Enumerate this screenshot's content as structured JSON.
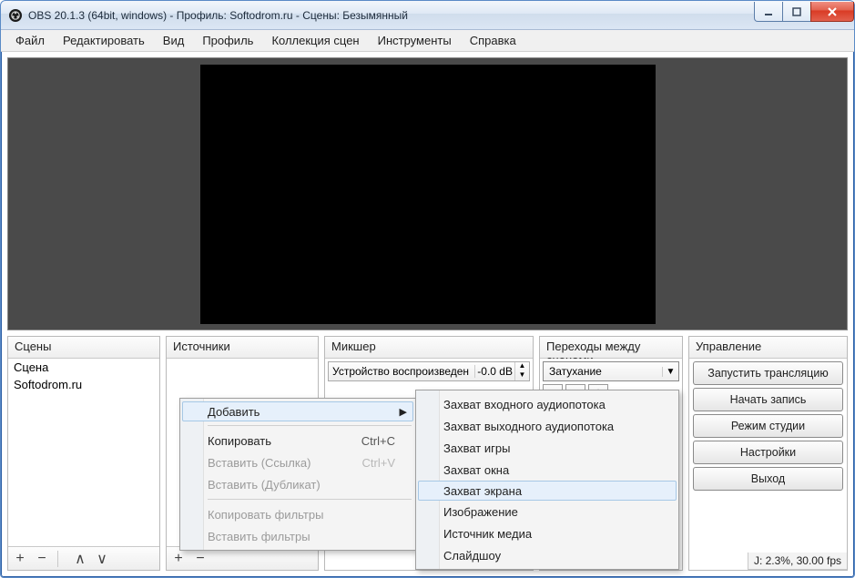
{
  "title": "OBS 20.1.3 (64bit, windows) - Профиль: Softodrom.ru - Сцены: Безымянный",
  "menubar": [
    "Файл",
    "Редактировать",
    "Вид",
    "Профиль",
    "Коллекция сцен",
    "Инструменты",
    "Справка"
  ],
  "panels": {
    "scenes": {
      "header": "Сцены",
      "items": [
        "Сцена",
        "Softodrom.ru"
      ]
    },
    "sources": {
      "header": "Источники"
    },
    "mixer": {
      "header": "Микшер",
      "device": "Устройство воспроизведен",
      "db": "-0.0 dB"
    },
    "transitions": {
      "header": "Переходы между сценами",
      "value": "Затухание"
    },
    "controls": {
      "header": "Управление",
      "buttons": [
        "Запустить трансляцию",
        "Начать запись",
        "Режим студии",
        "Настройки",
        "Выход"
      ]
    }
  },
  "footer_btns": {
    "plus": "+",
    "minus": "−",
    "up": "∧",
    "down": "∨",
    "gear": "⚙"
  },
  "status": "J: 2.3%, 30.00 fps",
  "ctx1": {
    "add": "Добавить",
    "copy": "Копировать",
    "copy_sc": "Ctrl+C",
    "paste_link": "Вставить (Ссылка)",
    "paste_sc": "Ctrl+V",
    "paste_dup": "Вставить (Дубликат)",
    "copy_filters": "Копировать фильтры",
    "paste_filters": "Вставить фильтры"
  },
  "ctx2": {
    "items": [
      "Захват входного аудиопотока",
      "Захват выходного аудиопотока",
      "Захват игры",
      "Захват окна",
      "Захват экрана",
      "Изображение",
      "Источник медиа",
      "Слайдшоу"
    ],
    "hl_index": 4
  }
}
